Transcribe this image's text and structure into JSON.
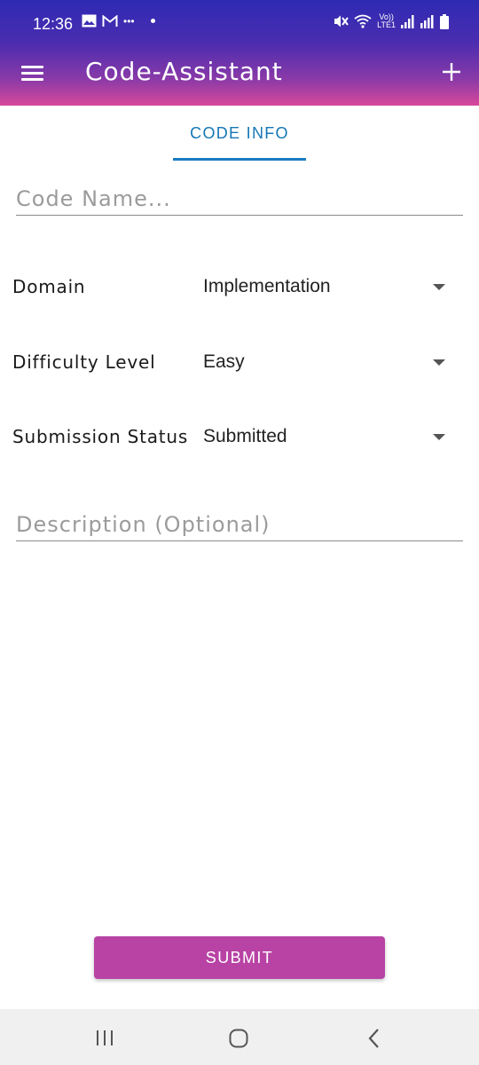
{
  "status_bar": {
    "time": "12:36",
    "icons_left": [
      "image-icon",
      "gmail-icon",
      "more-dots-icon",
      "dot-icon"
    ],
    "icons_right": [
      "mute-icon",
      "wifi-icon",
      "volte-lte-icon",
      "signal-icon",
      "signal-r-icon",
      "battery-icon"
    ],
    "volte_top": "Vo))",
    "volte_bottom": "LTE1",
    "more_dots": "•••"
  },
  "toolbar": {
    "title": "Code-Assistant",
    "menu_icon": "hamburger-menu-icon",
    "add_icon": "plus-icon"
  },
  "tabs": [
    {
      "label": "CODE INFO",
      "active": true
    }
  ],
  "form": {
    "code_name_placeholder": "Code Name...",
    "domain_label": "Domain",
    "domain_value": "Implementation",
    "difficulty_label": "Difficulty Level",
    "difficulty_value": "Easy",
    "status_label": "Submission Status",
    "status_value": "Submitted",
    "description_placeholder": "Description (Optional)"
  },
  "submit_label": "SUBMIT",
  "colors": {
    "appbar_gradient": [
      "#2e2bb3",
      "#d8489a"
    ],
    "tab_accent": "#1577b5",
    "submit_bg": "#b843a4",
    "navbar_bg": "#f0f0f0"
  },
  "nav_bar": {
    "icons": [
      "recent-apps-icon",
      "home-icon",
      "back-icon"
    ]
  }
}
